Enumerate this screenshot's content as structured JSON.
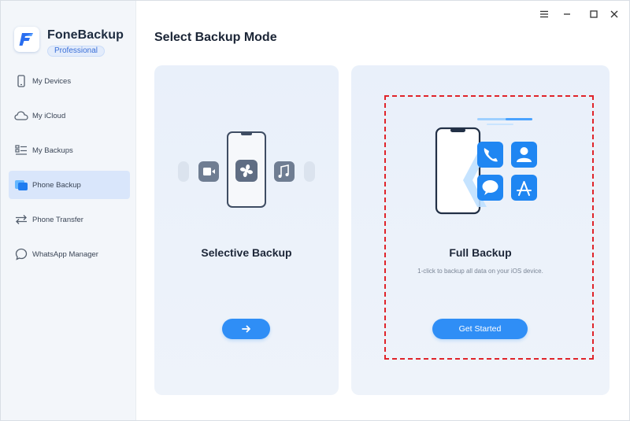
{
  "app": {
    "name": "FoneBackup",
    "edition": "Professional"
  },
  "sidebar": {
    "items": [
      {
        "label": "My Devices",
        "icon": "phone-icon",
        "active": false
      },
      {
        "label": "My iCloud",
        "icon": "cloud-icon",
        "active": false
      },
      {
        "label": "My Backups",
        "icon": "backups-icon",
        "active": false
      },
      {
        "label": "Phone Backup",
        "icon": "phone-backup-icon",
        "active": true
      },
      {
        "label": "Phone Transfer",
        "icon": "transfer-icon",
        "active": false
      },
      {
        "label": "WhatsApp Manager",
        "icon": "chat-icon",
        "active": false
      }
    ]
  },
  "window_controls": [
    "menu-icon",
    "minimize-icon",
    "maximize-icon",
    "close-icon"
  ],
  "main": {
    "title": "Select Backup Mode",
    "selective": {
      "title": "Selective Backup",
      "button_icon": "arrow-right-icon"
    },
    "full": {
      "title": "Full Backup",
      "description": "1-click to backup all data on your iOS device.",
      "button_label": "Get Started"
    }
  },
  "colors": {
    "accent": "#2f8ef6",
    "highlight_border": "#e0242a",
    "active_nav": "#d9e6fb"
  }
}
